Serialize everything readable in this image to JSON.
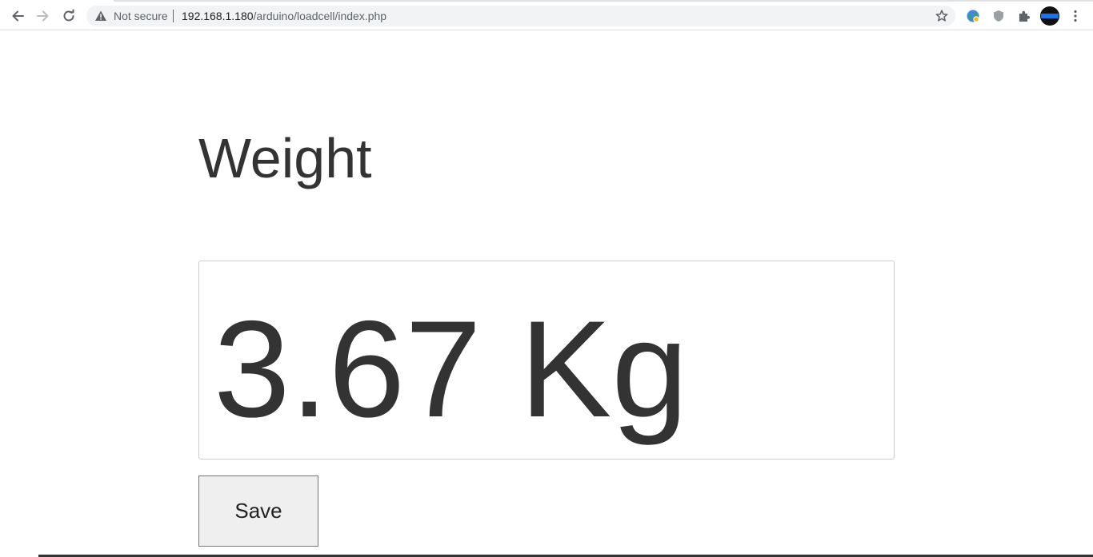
{
  "browser": {
    "security_label": "Not secure",
    "url_host": "192.168.1.180",
    "url_path": "/arduino/loadcell/index.php"
  },
  "page": {
    "title": "Weight",
    "weight_value": "3.67 Kg",
    "save_label": "Save"
  },
  "icons": {
    "back": "back-arrow-icon",
    "forward": "forward-arrow-icon",
    "reload": "reload-icon",
    "warning": "warning-icon",
    "star": "bookmark-star-icon",
    "extension_globe": "globe-extension-icon",
    "extension_shield": "shield-extension-icon",
    "extensions": "puzzle-icon",
    "profile": "profile-avatar",
    "menu": "kebab-menu-icon"
  },
  "colors": {
    "text": "#333333",
    "box_border": "#cccccc",
    "button_bg": "#efefef"
  }
}
